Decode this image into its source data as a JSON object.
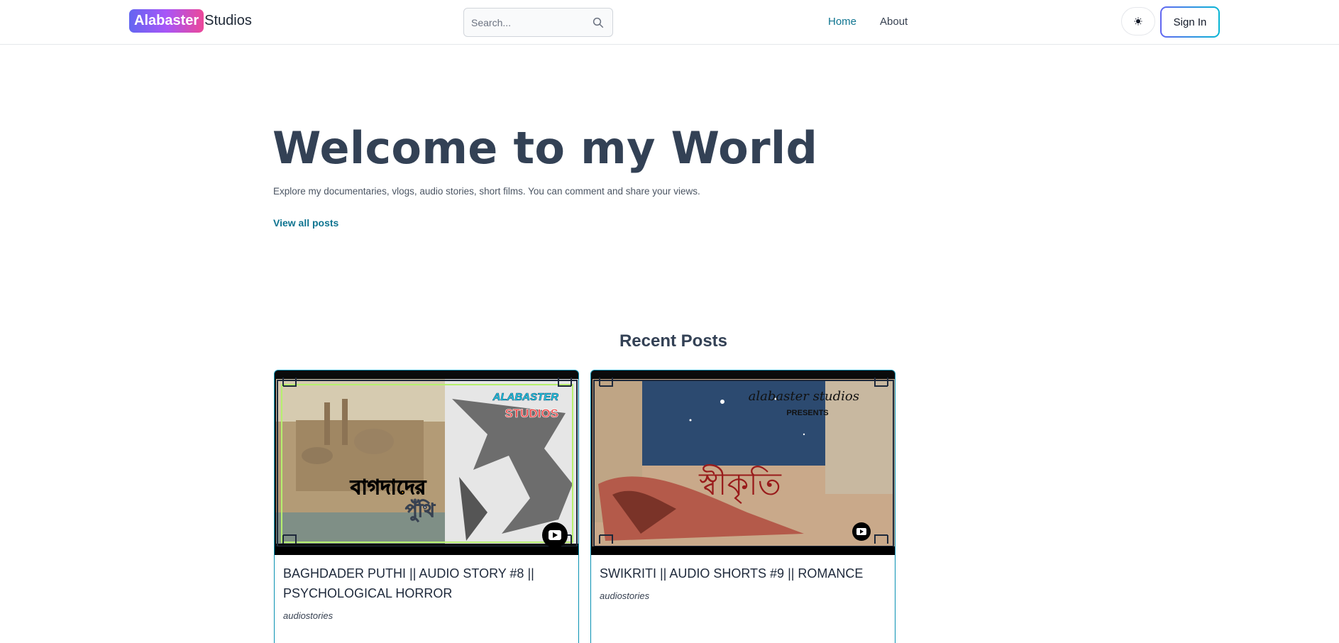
{
  "header": {
    "logo_badge": "Alabaster",
    "logo_rest": "Studios",
    "search_placeholder": "Search...",
    "nav": [
      {
        "label": "Home",
        "active": true
      },
      {
        "label": "About",
        "active": false
      }
    ],
    "theme_icon": "sun-icon",
    "signin_label": "Sign In"
  },
  "hero": {
    "title": "Welcome to my World",
    "subtitle": "Explore my documentaries, vlogs, audio stories, short films. You can comment and share your views.",
    "link": "View all posts"
  },
  "recent": {
    "title": "Recent Posts",
    "posts": [
      {
        "title": "BAGHDADER PUTHI || AUDIO STORY #8 || PSYCHOLOGICAL HORROR",
        "category": "audiostories",
        "thumb_text_bengali_1": "বাগদাদের",
        "thumb_text_bengali_2": "পুঁথি",
        "thumb_brand_1": "ALABASTER",
        "thumb_brand_2": "STUDIOS"
      },
      {
        "title": "SWIKRITI || AUDIO SHORTS #9 || ROMANCE",
        "category": "audiostories",
        "thumb_brand": "alabaster studios",
        "thumb_presents": "PRESENTS",
        "thumb_text_bengali": "স্বীকৃতি"
      }
    ]
  },
  "colors": {
    "accent": "#0e7490",
    "logo_gradient_start": "#6366f1",
    "logo_gradient_end": "#ec4899",
    "card_border": "#0891b2"
  }
}
